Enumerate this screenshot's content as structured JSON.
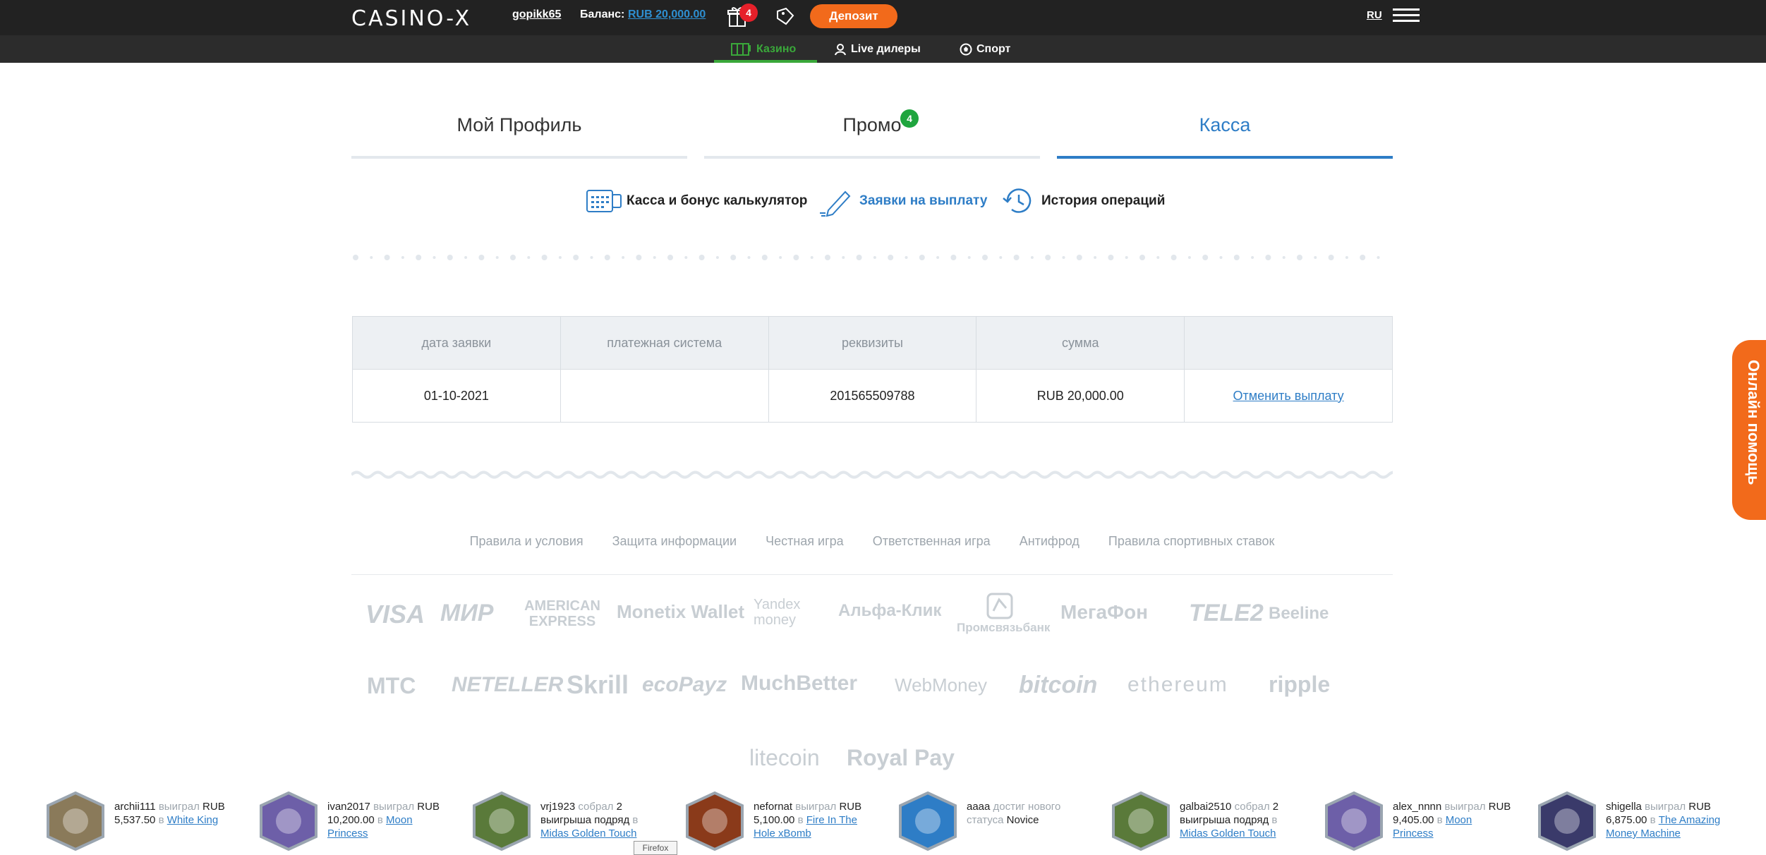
{
  "header": {
    "logo": "CASINO-X",
    "username": "gopikk65",
    "balance_label": "Баланс:",
    "balance_value": "RUB 20,000.00",
    "gift_count": "4",
    "deposit_label": "Депозит",
    "language": "RU"
  },
  "subnav": {
    "items": [
      "Казино",
      "Live дилеры",
      "Спорт"
    ],
    "active": "Казино",
    "accent": "#3aa83a"
  },
  "tabs": {
    "items": [
      "Мой Профиль",
      "Промо",
      "Касса"
    ],
    "promo_badge": "4",
    "active": "Касса"
  },
  "subtabs": {
    "items": [
      "Касса и бонус калькулятор",
      "Заявки на выплату",
      "История операций"
    ],
    "active": "Заявки на выплату"
  },
  "requests_table": {
    "headers": [
      "дата заявки",
      "платежная система",
      "реквизиты",
      "сумма",
      ""
    ],
    "rows": [
      {
        "date": "01-10-2021",
        "system": "",
        "details": "201565509788",
        "amount": "RUB 20,000.00",
        "action": "Отменить выплату"
      }
    ]
  },
  "footer": {
    "links": [
      "Правила и условия",
      "Защита информации",
      "Честная игра",
      "Ответственная игра",
      "Антифрод",
      "Правила спортивных ставок"
    ],
    "payment_logos": [
      "VISA",
      "МИР",
      "AMERICAN EXPRESS",
      "Monetix Wallet",
      "Yandex money",
      "Альфа-Клик",
      "Промсвязьбанк",
      "МегаФон",
      "TELE2",
      "Beeline",
      "МТС",
      "NETELLER",
      "Skrill",
      "ecoPayz",
      "MuchBetter",
      "WebMoney",
      "bitcoin",
      "ethereum",
      "ripple",
      "litecoin",
      "Royal Pay"
    ]
  },
  "help_tab": "Онлайн помощь",
  "winners": [
    {
      "user": "archii111",
      "verb": "выиграл",
      "amount": "RUB 5,537.50",
      "prep": "в",
      "game": "White King"
    },
    {
      "user": "ivan2017",
      "verb": "выиграл",
      "amount": "RUB 10,200.00",
      "prep": "в",
      "game": "Moon Princess"
    },
    {
      "user": "vrj1923",
      "verb": "собрал",
      "amount": "2 выигрыша подряд",
      "prep": "в",
      "game": "Midas Golden Touch"
    },
    {
      "user": "nefornat",
      "verb": "выиграл",
      "amount": "RUB 5,100.00",
      "prep": "в",
      "game": "Fire In The Hole xBomb"
    },
    {
      "user": "aaaa",
      "verb": "достиг нового статуса",
      "amount": "",
      "prep": "",
      "game": "Novice"
    },
    {
      "user": "galbai2510",
      "verb": "собрал",
      "amount": "2 выигрыша подряд",
      "prep": "в",
      "game": "Midas Golden Touch"
    },
    {
      "user": "alex_nnnn",
      "verb": "выиграл",
      "amount": "RUB 9,405.00",
      "prep": "в",
      "game": "Moon Princess"
    },
    {
      "user": "shigella",
      "verb": "выиграл",
      "amount": "RUB 6,875.00",
      "prep": "в",
      "game": "The Amazing Money Machine"
    }
  ],
  "tooltip": "Firefox"
}
